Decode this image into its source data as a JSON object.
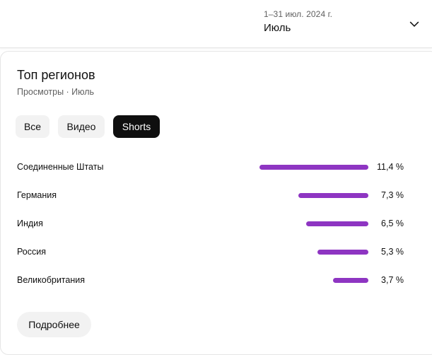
{
  "period": {
    "range": "1–31 июл. 2024 г.",
    "name": "Июль"
  },
  "card": {
    "title": "Топ регионов",
    "subtitle": "Просмотры · Июль"
  },
  "filters": [
    {
      "label": "Все",
      "active": false
    },
    {
      "label": "Видео",
      "active": false
    },
    {
      "label": "Shorts",
      "active": true
    }
  ],
  "regions": [
    {
      "name": "Соединенные Штаты",
      "percent": 11.4,
      "display": "11,4 %"
    },
    {
      "name": "Германия",
      "percent": 7.3,
      "display": "7,3 %"
    },
    {
      "name": "Индия",
      "percent": 6.5,
      "display": "6,5 %"
    },
    {
      "name": "Россия",
      "percent": 5.3,
      "display": "5,3 %"
    },
    {
      "name": "Великобритания",
      "percent": 3.7,
      "display": "3,7 %"
    }
  ],
  "more_label": "Подробнее",
  "colors": {
    "bar": "#8e35c2",
    "chip_active_bg": "#0f0f0f",
    "chip_bg": "#f2f2f2"
  },
  "icons": {
    "period_dropdown": "chevron-down-icon"
  }
}
